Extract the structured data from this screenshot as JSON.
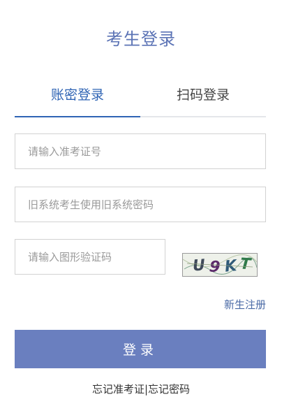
{
  "page": {
    "title": "考生登录"
  },
  "tabs": [
    {
      "label": "账密登录",
      "active": true
    },
    {
      "label": "扫码登录",
      "active": false
    }
  ],
  "form": {
    "id_placeholder": "请输入准考证号",
    "id_value": "",
    "password_placeholder": "旧系统考生使用旧系统密码",
    "password_value": "",
    "captcha_placeholder": "请输入图形验证码",
    "captcha_value": "",
    "captcha_image_text": "U9KT"
  },
  "links": {
    "register": "新生注册",
    "forgot_id": "忘记准考证",
    "separator": "|",
    "forgot_password": "忘记密码"
  },
  "buttons": {
    "login": "登录"
  },
  "colors": {
    "accent": "#2f64b4",
    "title": "#5b73b5",
    "button": "#6a7fbf",
    "link": "#4a6aa6"
  }
}
